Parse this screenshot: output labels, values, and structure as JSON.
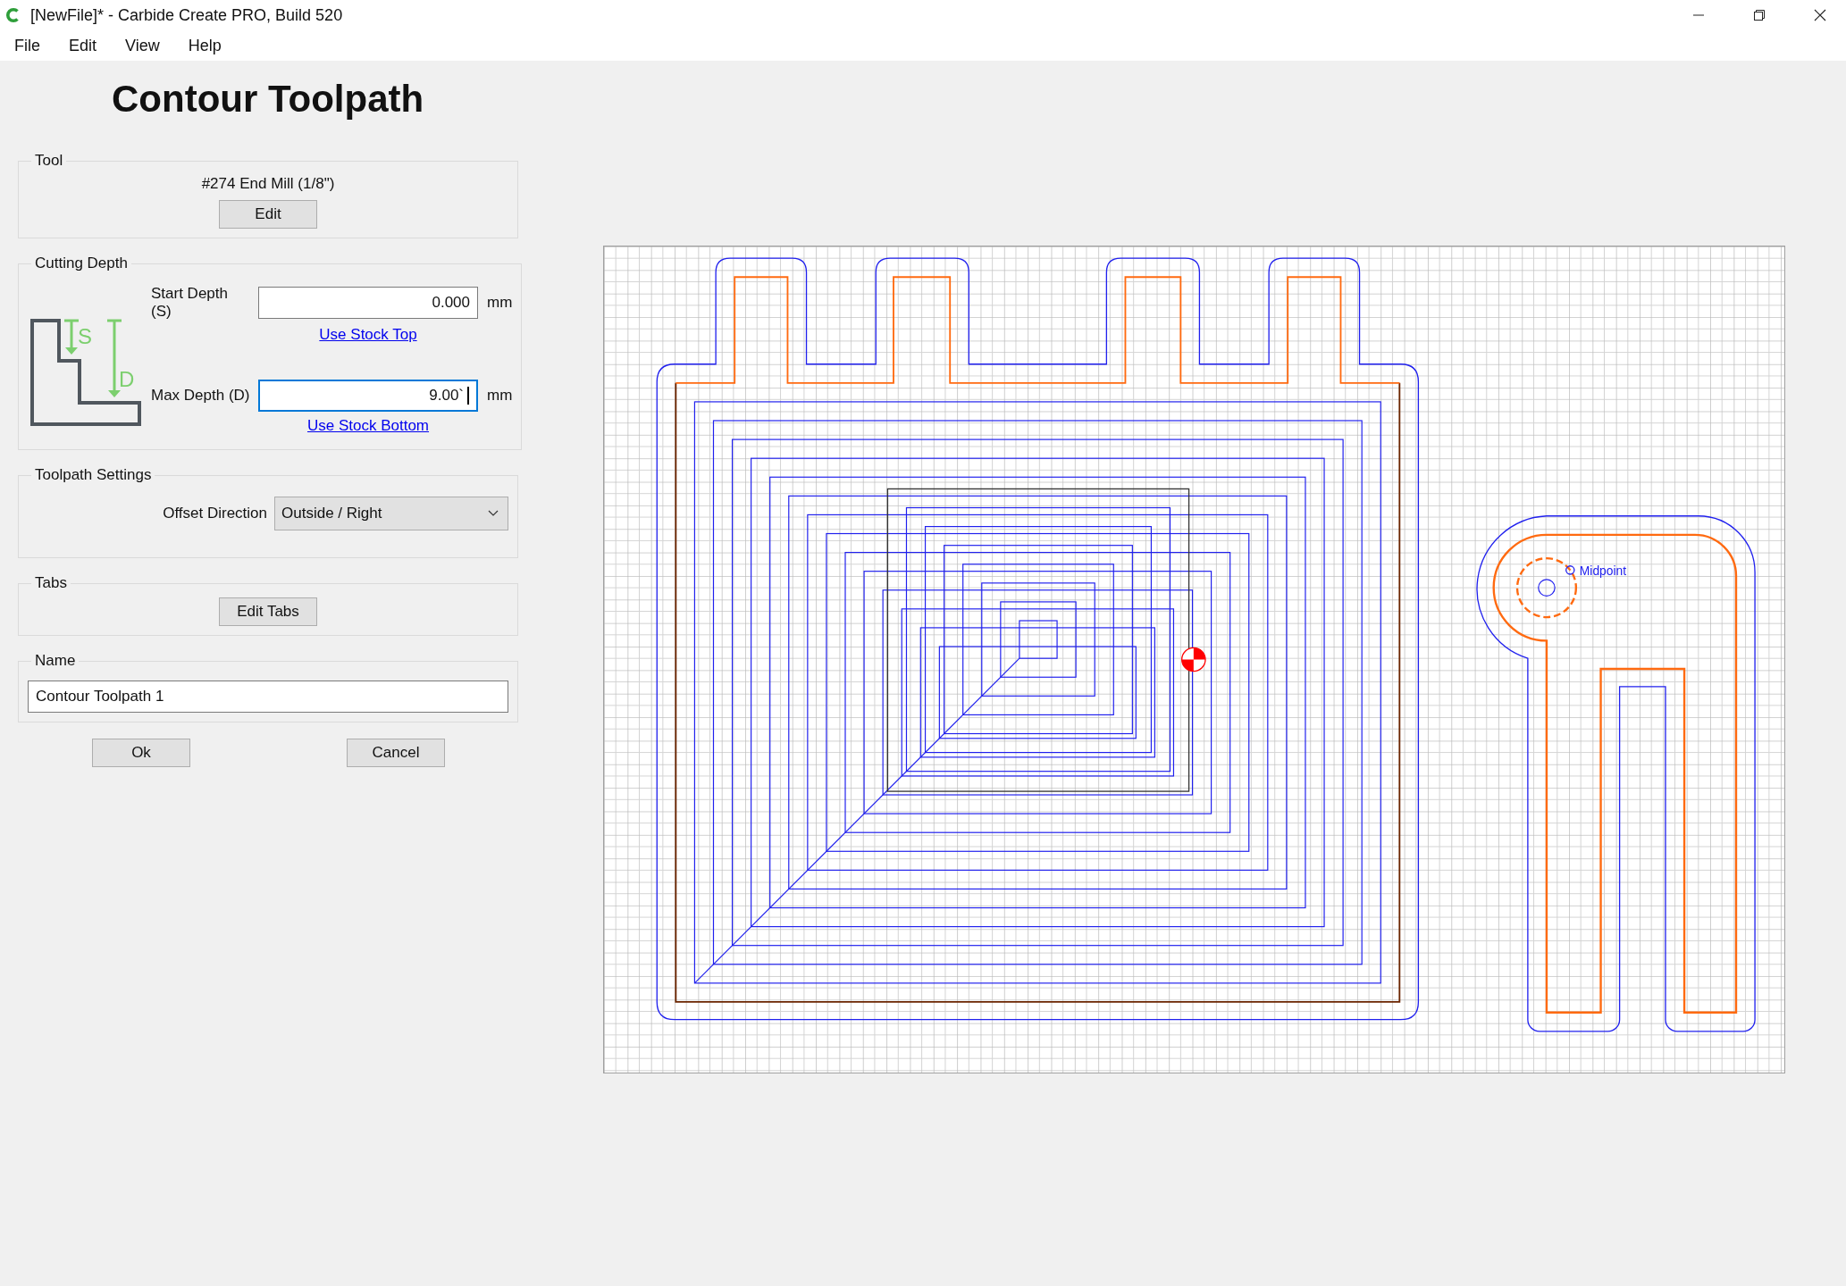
{
  "window": {
    "title": "[NewFile]* - Carbide Create PRO, Build 520"
  },
  "menu": [
    {
      "label": "File"
    },
    {
      "label": "Edit"
    },
    {
      "label": "View"
    },
    {
      "label": "Help"
    }
  ],
  "panel": {
    "title": "Contour Toolpath",
    "tool": {
      "legend": "Tool",
      "tool_name": "#274 End Mill (1/8\")",
      "button": "Edit"
    },
    "cutting_depth": {
      "legend": "Cutting Depth",
      "diagram_labels": [
        "S",
        "D"
      ],
      "fields": [
        {
          "label": "Start Depth (S)",
          "value": "0.000",
          "unit": "mm",
          "link": "Use Stock Top",
          "focused": false
        },
        {
          "label": "Max Depth (D)",
          "value": "9.00`",
          "unit": "mm",
          "link": "Use Stock Bottom",
          "focused": true
        }
      ]
    },
    "toolpath_settings": {
      "legend": "Toolpath Settings",
      "offset_label": "Offset Direction",
      "offset_value": "Outside / Right"
    },
    "tabs": {
      "legend": "Tabs",
      "button": "Edit Tabs"
    },
    "name": {
      "legend": "Name",
      "value": "Contour Toolpath 1"
    },
    "buttons": [
      "Ok",
      "Cancel"
    ]
  },
  "canvas": {
    "midpoint_label": "Midpoint"
  }
}
